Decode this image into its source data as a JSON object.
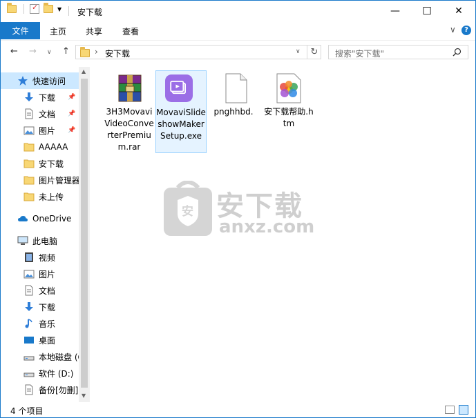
{
  "window": {
    "title": "安下载",
    "controls": {
      "minimize": "—",
      "maximize": "☐",
      "close": "✕"
    }
  },
  "ribbon": {
    "tabs": [
      "文件",
      "主页",
      "共享",
      "查看"
    ],
    "collapse_glyph": "∨",
    "help_glyph": "?"
  },
  "address": {
    "path_sep": "›",
    "path": "安下载",
    "search_placeholder": "搜索\"安下载\""
  },
  "sidebar": {
    "items": [
      {
        "label": "快速访问",
        "icon": "star-icon"
      },
      {
        "label": "下载",
        "icon": "download-arrow-icon",
        "pinned": true
      },
      {
        "label": "文档",
        "icon": "document-icon",
        "pinned": true
      },
      {
        "label": "图片",
        "icon": "picture-icon",
        "pinned": true
      },
      {
        "label": "AAAAA",
        "icon": "folder-icon"
      },
      {
        "label": "安下载",
        "icon": "folder-icon"
      },
      {
        "label": "图片管理器",
        "icon": "folder-icon"
      },
      {
        "label": "未上传",
        "icon": "folder-icon"
      },
      {
        "label": "OneDrive",
        "icon": "cloud-icon"
      },
      {
        "label": "此电脑",
        "icon": "computer-icon"
      },
      {
        "label": "视频",
        "icon": "video-icon"
      },
      {
        "label": "图片",
        "icon": "picture-icon"
      },
      {
        "label": "文档",
        "icon": "document-icon"
      },
      {
        "label": "下载",
        "icon": "download-arrow-icon"
      },
      {
        "label": "音乐",
        "icon": "music-icon"
      },
      {
        "label": "桌面",
        "icon": "desktop-icon"
      },
      {
        "label": "本地磁盘 (C",
        "icon": "drive-icon"
      },
      {
        "label": "软件 (D:)",
        "icon": "drive-icon"
      },
      {
        "label": "备份[勿删]",
        "icon": "document-icon"
      }
    ]
  },
  "files": [
    {
      "name": "3H3MovaviVideoConverterPremium.rar",
      "icon": "winrar-archive-icon"
    },
    {
      "name": "MovaviSlideshowMakerSetup.exe",
      "icon": "movavi-app-icon"
    },
    {
      "name": "pnghhbd.",
      "icon": "blank-file-icon"
    },
    {
      "name": "安下载帮助.htm",
      "icon": "html-file-icon"
    }
  ],
  "watermark": {
    "text_cn": "安下载",
    "text_en": "anxz.com",
    "shield_char": "安"
  },
  "status": {
    "item_count": "4 个项目"
  },
  "colors": {
    "accent": "#1979ca",
    "selected_bg": "#cce8ff",
    "file_selected_bg": "#e5f3ff"
  }
}
